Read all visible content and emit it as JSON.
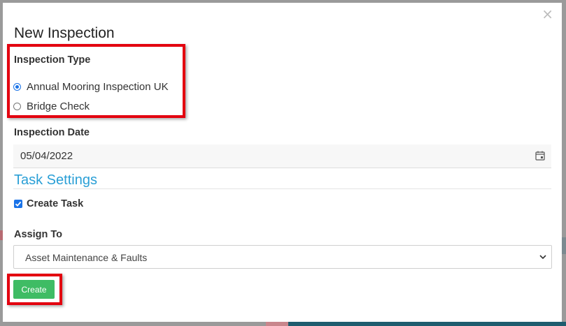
{
  "modal": {
    "title": "New Inspection",
    "close_symbol": "×"
  },
  "inspection_type": {
    "label": "Inspection Type",
    "options": [
      {
        "label": "Annual Mooring Inspection UK",
        "checked": true
      },
      {
        "label": "Bridge Check",
        "checked": false
      }
    ]
  },
  "inspection_date": {
    "label": "Inspection Date",
    "value": "05/04/2022",
    "icon": "calendar-icon"
  },
  "task_settings": {
    "title": "Task Settings",
    "create_task_label": "Create Task",
    "create_task_checked": true
  },
  "assign_to": {
    "label": "Assign To",
    "selected": "Asset Maintenance & Faults",
    "icon": "chevron-down-icon"
  },
  "actions": {
    "create_label": "Create"
  },
  "colors": {
    "accent_blue": "#2a9fd6",
    "button_green": "#3fbc64",
    "highlight_red": "#e3000f",
    "radio_blue": "#1a73e8"
  }
}
